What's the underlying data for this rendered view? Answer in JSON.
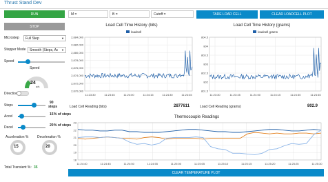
{
  "app": {
    "title": "Thrust Stand Dev"
  },
  "controls": {
    "run_label": "RUN",
    "stop_label": "STOP",
    "microstep_label": "Microstep",
    "microstep_value": "Full Step",
    "stepper_mode_label": "Stepper Mode",
    "stepper_mode_value": "Smooth (Steps, Ac",
    "speed_label": "Speed",
    "speed_gauge_title": "Speed",
    "speed_value": "24",
    "speed_unit": "u/s",
    "speed_fraction": 0.24,
    "direction_label": "Direction",
    "steps_label": "Steps",
    "steps_value": "90",
    "steps_unit": "steps",
    "accel_label": "Accel",
    "accel_value": "15",
    "accel_unit": "% of steps",
    "decel_label": "Decel",
    "decel_value": "20",
    "decel_unit": "% of steps",
    "accel_gauge_title": "Acceleration %",
    "accel_gauge_value": "15",
    "decel_gauge_title": "Deceleration %",
    "decel_gauge_value": "20",
    "total_label": "Total Transient %:",
    "total_value": "35"
  },
  "fields": {
    "m_placeholder": "M =",
    "b_placeholder": "B =",
    "cutoff_placeholder": "Cutoff ="
  },
  "buttons": {
    "tare": "TARE LOAD CELL",
    "clear_loadcell": "CLEAR LOADCELL PLOT",
    "clear_temp": "CLEAR TEMPERATURE PLOT"
  },
  "readings": {
    "bits_label": "Load Cell Reading (bits)",
    "bits_value": "2877611",
    "grams_label": "Load Cell Reading (grams)",
    "grams_value": "802.9"
  },
  "chart_data": [
    {
      "type": "line",
      "title": "Load Cell Time History (bits)",
      "legend": [
        "loadcell"
      ],
      "yticks": [
        "2,884,000",
        "2,882,000",
        "2,880,000",
        "2,878,000",
        "2,876,000",
        "2,874,000",
        "2,872,000",
        "2,870,000"
      ],
      "xticks": [
        "11:23:30",
        "11:23:45",
        "11:24:00",
        "11:24:15",
        "11:24:30",
        "11:24:45"
      ],
      "ylim": [
        2870000,
        2884000
      ],
      "baseline": 2874000,
      "spike": 2880500
    },
    {
      "type": "line",
      "title": "Load Cell Time History (grams)",
      "legend": [
        "loadcell grams"
      ],
      "yticks": [
        "804.5",
        "804",
        "803.5",
        "803",
        "802.5",
        "802",
        "801.5"
      ],
      "xticks": [
        "11:23:30",
        "11:23:45",
        "11:24:00",
        "11:24:15",
        "11:24:30",
        "11:24:45"
      ],
      "ylim": [
        801.5,
        804.5
      ],
      "baseline": 802.3,
      "spike": 803.9
    },
    {
      "type": "line",
      "title": "Thermocouple Readings",
      "yticks": [
        "23",
        "22",
        "21",
        "20",
        "19",
        "18"
      ],
      "xticks": [
        "11:24:40",
        "11:24:45",
        "11:24:50",
        "11:24:55",
        "11:25:00",
        "11:25:05",
        "11:25:10",
        "11:25:15",
        "11:25:20",
        "11:25:25",
        "11:25:30"
      ],
      "ylim": [
        18,
        23
      ],
      "series": [
        {
          "color": "#1f5fa8",
          "values": [
            22.1,
            22.0,
            22.0,
            21.9,
            21.9,
            22.0,
            22.0,
            21.8,
            21.8,
            21.7,
            21.7,
            21.7,
            21.8,
            21.9,
            22.0,
            22.1,
            22.1,
            22.0,
            21.9,
            21.8,
            21.8,
            21.7,
            21.7,
            21.8,
            21.9,
            22.0,
            22.1,
            22.1,
            22.0,
            21.9,
            21.9,
            22.0,
            22.1,
            22.0
          ]
        },
        {
          "color": "#e3801e",
          "values": [
            20.9,
            20.8,
            20.9,
            21.0,
            21.1,
            21.0,
            20.9,
            20.9,
            20.8,
            21.0,
            21.1,
            21.0,
            20.8,
            20.9,
            20.9,
            20.9,
            20.9,
            20.8,
            20.9,
            20.9,
            20.9,
            20.9,
            20.9,
            21.5,
            21.7,
            21.6,
            21.5,
            21.6,
            21.5,
            21.5,
            21.6,
            21.6,
            21.5,
            21.6
          ]
        },
        {
          "color": "#8ab4e8",
          "values": [
            21.0,
            21.1,
            21.1,
            21.0,
            21.1,
            21.0,
            20.9,
            20.4,
            20.1,
            20.2,
            20.0,
            20.2,
            20.9,
            21.0,
            21.0,
            21.0,
            21.1,
            21.0,
            19.8,
            19.5,
            19.4,
            18.9,
            18.9,
            18.8,
            18.7,
            18.9,
            19.4,
            19.5,
            19.9,
            20.2,
            20.1,
            20.2,
            21.4,
            22.0
          ]
        }
      ]
    }
  ]
}
